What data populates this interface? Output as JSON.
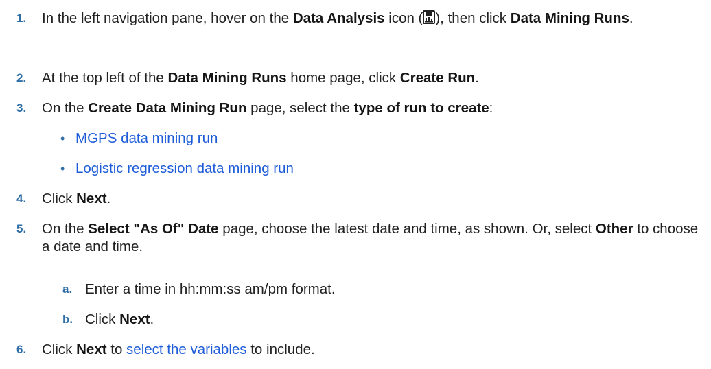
{
  "steps": [
    {
      "num": "1.",
      "pre": "In the left navigation pane, hover on the ",
      "b1": "Data Analysis",
      "mid1": " icon (",
      "mid2": "), then click ",
      "b2": "Data Mining Runs",
      "post": ".",
      "icon": "data-analysis-icon"
    },
    {
      "num": "2.",
      "pre": "At the top left of the ",
      "b1": "Data Mining Runs",
      "mid": " home page, click ",
      "b2": "Create Run",
      "post": "."
    },
    {
      "num": "3.",
      "pre": "On the ",
      "b1": "Create Data Mining Run",
      "mid": " page, select the ",
      "b2": "type of run to create",
      "post": ":",
      "bullets": [
        {
          "bullet": "•",
          "label": "MGPS data mining run"
        },
        {
          "bullet": "•",
          "label": "Logistic regression data mining run"
        }
      ]
    },
    {
      "num": "4.",
      "pre": "Click ",
      "b1": "Next",
      "post": "."
    },
    {
      "num": "5.",
      "pre": "On the ",
      "b1": "Select \"As Of\" Date",
      "mid": " page, choose the latest date and time, as shown. Or, select ",
      "b2": "Other",
      "post": " to choose a date and time.",
      "substeps": [
        {
          "letter": "a.",
          "text": "Enter a time in hh:mm:ss am/pm format."
        },
        {
          "letter": "b.",
          "pre": "Click ",
          "b1": "Next",
          "post": "."
        }
      ]
    },
    {
      "num": "6.",
      "pre": "Click ",
      "b1": "Next",
      "mid": " to ",
      "link": "select the variables",
      "post": " to include."
    }
  ],
  "colors": {
    "text": "#222222",
    "number": "#2f6ea6",
    "link": "#1e5cd8"
  }
}
